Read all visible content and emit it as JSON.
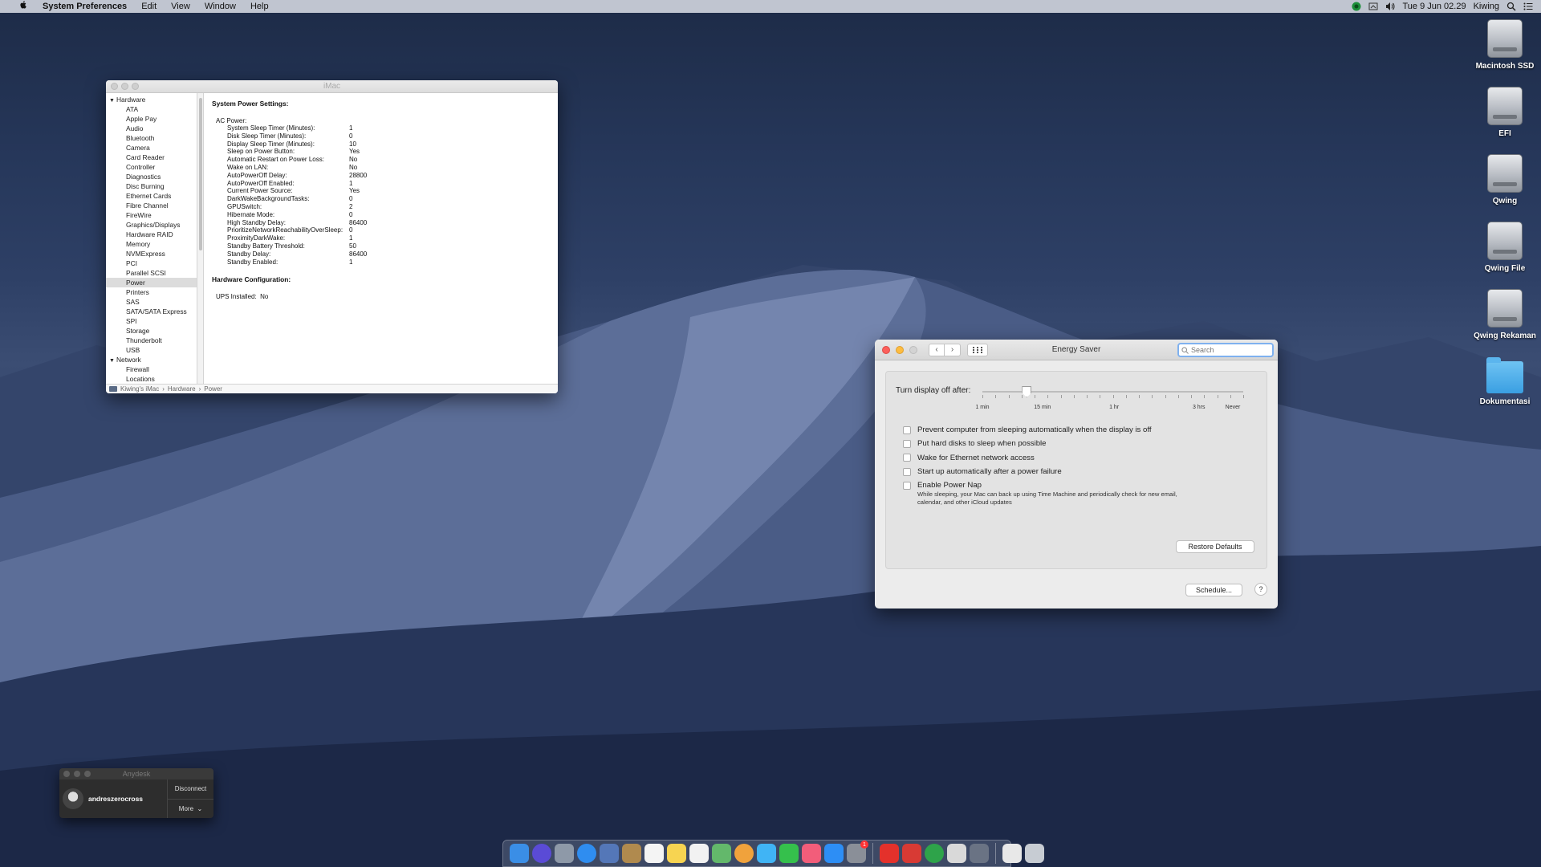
{
  "menubar": {
    "app_name": "System Preferences",
    "menus": [
      "Edit",
      "View",
      "Window",
      "Help"
    ],
    "clock": "Tue 9 Jun  02.29",
    "user": "Kiwing"
  },
  "desktop_icons": [
    {
      "label": "Macintosh SSD",
      "icon": "hard-drive-icon"
    },
    {
      "label": "EFI",
      "icon": "hard-drive-icon"
    },
    {
      "label": "Qwing",
      "icon": "hard-drive-icon"
    },
    {
      "label": "Qwing File",
      "icon": "hard-drive-icon"
    },
    {
      "label": "Qwing Rekaman",
      "icon": "hard-drive-icon"
    },
    {
      "label": "Dokumentasi",
      "icon": "folder-icon"
    }
  ],
  "sysinfo": {
    "title": "iMac",
    "sidebar": {
      "hardware_label": "Hardware",
      "hardware_items": [
        "ATA",
        "Apple Pay",
        "Audio",
        "Bluetooth",
        "Camera",
        "Card Reader",
        "Controller",
        "Diagnostics",
        "Disc Burning",
        "Ethernet Cards",
        "Fibre Channel",
        "FireWire",
        "Graphics/Displays",
        "Hardware RAID",
        "Memory",
        "NVMExpress",
        "PCI",
        "Parallel SCSI",
        "Power",
        "Printers",
        "SAS",
        "SATA/SATA Express",
        "SPI",
        "Storage",
        "Thunderbolt",
        "USB"
      ],
      "selected": "Power",
      "network_label": "Network",
      "network_items": [
        "Firewall",
        "Locations"
      ]
    },
    "heading": "System Power Settings:",
    "ac_power_label": "AC Power:",
    "settings": [
      {
        "key": "System Sleep Timer (Minutes):",
        "value": "1"
      },
      {
        "key": "Disk Sleep Timer (Minutes):",
        "value": "0"
      },
      {
        "key": "Display Sleep Timer (Minutes):",
        "value": "10"
      },
      {
        "key": "Sleep on Power Button:",
        "value": "Yes"
      },
      {
        "key": "Automatic Restart on Power Loss:",
        "value": "No"
      },
      {
        "key": "Wake on LAN:",
        "value": "No"
      },
      {
        "key": "AutoPowerOff Delay:",
        "value": "28800"
      },
      {
        "key": "AutoPowerOff Enabled:",
        "value": "1"
      },
      {
        "key": "Current Power Source:",
        "value": "Yes"
      },
      {
        "key": "DarkWakeBackgroundTasks:",
        "value": "0"
      },
      {
        "key": "GPUSwitch:",
        "value": "2"
      },
      {
        "key": "Hibernate Mode:",
        "value": "0"
      },
      {
        "key": "High Standby Delay:",
        "value": "86400"
      },
      {
        "key": "PrioritizeNetworkReachabilityOverSleep:",
        "value": "0"
      },
      {
        "key": "ProximityDarkWake:",
        "value": "1"
      },
      {
        "key": "Standby Battery Threshold:",
        "value": "50"
      },
      {
        "key": "Standby Delay:",
        "value": "86400"
      },
      {
        "key": "Standby Enabled:",
        "value": "1"
      }
    ],
    "hw_config_heading": "Hardware Configuration:",
    "ups_label": "UPS Installed:",
    "ups_value": "No",
    "path": [
      "Kiwing's iMac",
      "Hardware",
      "Power"
    ],
    "path_sep": "›"
  },
  "energy": {
    "title": "Energy Saver",
    "search_placeholder": "Search",
    "slider_label": "Turn display off after:",
    "slider_position_fraction": 0.17,
    "tick_labels": [
      {
        "label": "1 min",
        "frac": 0.0
      },
      {
        "label": "15 min",
        "frac": 0.23
      },
      {
        "label": "1 hr",
        "frac": 0.505
      },
      {
        "label": "3 hrs",
        "frac": 0.83
      },
      {
        "label": "Never",
        "frac": 0.96
      }
    ],
    "options": [
      {
        "label": "Prevent computer from sleeping automatically when the display is off",
        "checked": false
      },
      {
        "label": "Put hard disks to sleep when possible",
        "checked": false
      },
      {
        "label": "Wake for Ethernet network access",
        "checked": false
      },
      {
        "label": "Start up automatically after a power failure",
        "checked": false
      },
      {
        "label": "Enable Power Nap",
        "checked": false
      }
    ],
    "power_nap_desc": "While sleeping, your Mac can back up using Time Machine and periodically check for new email, calendar, and other iCloud updates",
    "restore_button": "Restore Defaults",
    "schedule_button": "Schedule...",
    "help_button": "?"
  },
  "anydesk": {
    "title": "Anydesk",
    "user": "andreszerocross",
    "disconnect": "Disconnect",
    "more": "More"
  },
  "dock": {
    "badge": "1",
    "colors": {
      "finder": "#3a8ee6",
      "siri": "#5a4bd6",
      "launchpad": "#8e99a8",
      "safari": "#2f8df0",
      "photos_app": "#5477b8",
      "notes_brown": "#b08a4e",
      "calendar": "#f4f4f4",
      "notes": "#f7d451",
      "reminders": "#f2f2f2",
      "maps": "#63b86b",
      "photos": "#f0a23c",
      "messages": "#40b4f5",
      "facetime": "#35c04c",
      "music": "#f25d7a",
      "appstore": "#2d8ef5",
      "prefs": "#8a8f98",
      "anydesk": "#e4312b",
      "anydesk2": "#d83a34",
      "globe": "#2ea34a",
      "preview": "#d9d9d9",
      "terminal": "#6a7384",
      "document": "#e8e8e8",
      "trash": "#c7ccd3"
    }
  }
}
